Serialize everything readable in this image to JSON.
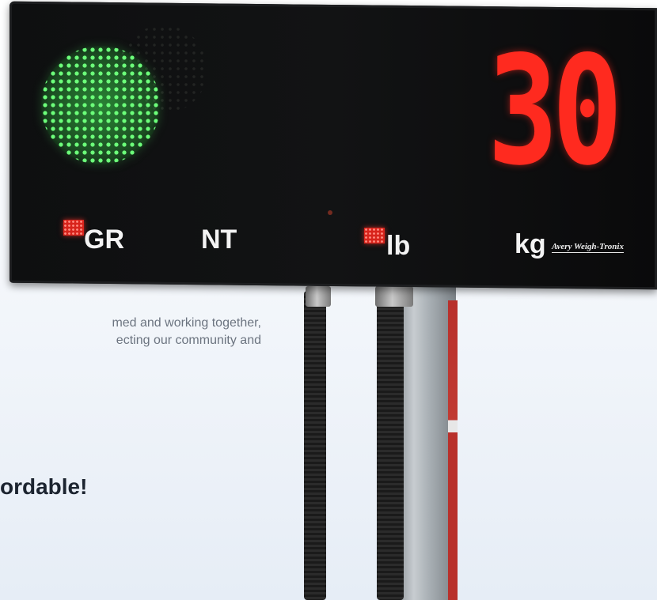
{
  "background_text": {
    "line1": "med and working together,",
    "line2": "ecting our community and",
    "headline": "ordable!"
  },
  "display": {
    "weight": "30",
    "units": {
      "gross": "GR",
      "net": "NT",
      "pounds": "lb",
      "kilograms": "kg"
    },
    "brand": "Avery Weigh-Tronix",
    "traffic_light_state": "green",
    "colors": {
      "digits": "#ff2a1f",
      "traffic_light": "#4cff5a",
      "indicator": "#d8241c"
    }
  }
}
